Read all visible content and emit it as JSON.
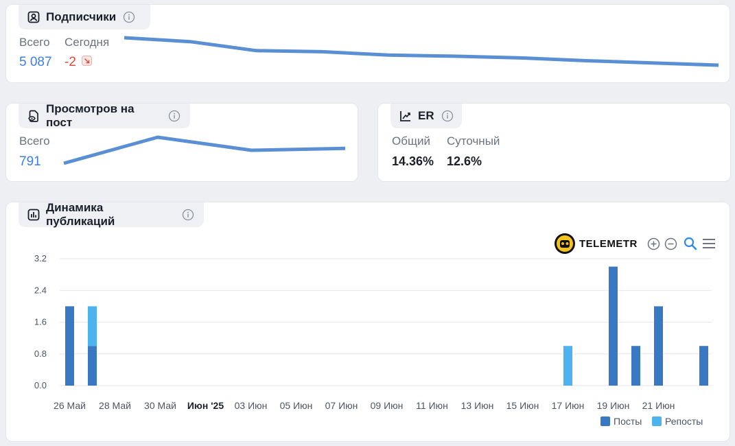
{
  "subscribers": {
    "title": "Подписчики",
    "total_label": "Всего",
    "total_value": "5 087",
    "today_label": "Сегодня",
    "today_value": "-2",
    "trend": [
      5145,
      5138,
      5122,
      5120,
      5114,
      5112,
      5109,
      5104,
      5100,
      5096
    ]
  },
  "views": {
    "title": "Просмотров на пост",
    "total_label": "Всего",
    "total_value": "791",
    "trend": [
      730,
      800,
      765,
      770
    ]
  },
  "er": {
    "title": "ER",
    "common_label": "Общий",
    "common_value": "14.36%",
    "daily_label": "Суточный",
    "daily_value": "12.6%"
  },
  "dynamics": {
    "title": "Динамика публикаций",
    "logo_text": "TELEMETR"
  },
  "colors": {
    "posts": "#3a78c4",
    "reposts": "#4db3ee",
    "line": "#5b8fd4",
    "accent": "#3d7ee6",
    "negative": "#e0483d"
  },
  "chart_data": {
    "type": "bar",
    "stacked": true,
    "x_ticks": [
      "26 Май",
      "28 Май",
      "30 Май",
      "Июн '25",
      "03 Июн",
      "05 Июн",
      "07 Июн",
      "09 Июн",
      "11 Июн",
      "13 Июн",
      "15 Июн",
      "17 Июн",
      "19 Июн",
      "21 Июн"
    ],
    "x_ticks_bold": [
      "Июн '25"
    ],
    "y_ticks": [
      "0.0",
      "0.8",
      "1.6",
      "2.4",
      "3.2"
    ],
    "ylim": [
      0,
      3.2
    ],
    "categories": [
      "26 Май",
      "27 Май",
      "28 Май",
      "29 Май",
      "30 Май",
      "31 Май",
      "01 Июн",
      "02 Июн",
      "03 Июн",
      "04 Июн",
      "05 Июн",
      "06 Июн",
      "07 Июн",
      "08 Июн",
      "09 Июн",
      "10 Июн",
      "11 Июн",
      "12 Июн",
      "13 Июн",
      "14 Июн",
      "15 Июн",
      "16 Июн",
      "17 Июн",
      "18 Июн",
      "19 Июн",
      "20 Июн",
      "21 Июн",
      "22 Июн",
      "23 Июн"
    ],
    "series": [
      {
        "name": "Посты",
        "values": [
          2,
          1,
          0,
          0,
          0,
          0,
          0,
          0,
          0,
          0,
          0,
          0,
          0,
          0,
          0,
          0,
          0,
          0,
          0,
          0,
          0,
          0,
          0,
          0,
          3,
          1,
          2,
          0,
          1
        ]
      },
      {
        "name": "Репосты",
        "values": [
          0,
          1,
          0,
          0,
          0,
          0,
          0,
          0,
          0,
          0,
          0,
          0,
          0,
          0,
          0,
          0,
          0,
          0,
          0,
          0,
          0,
          0,
          1,
          0,
          0,
          0,
          0,
          0,
          0
        ]
      }
    ],
    "grid": true,
    "legend_position": "bottom-right"
  }
}
